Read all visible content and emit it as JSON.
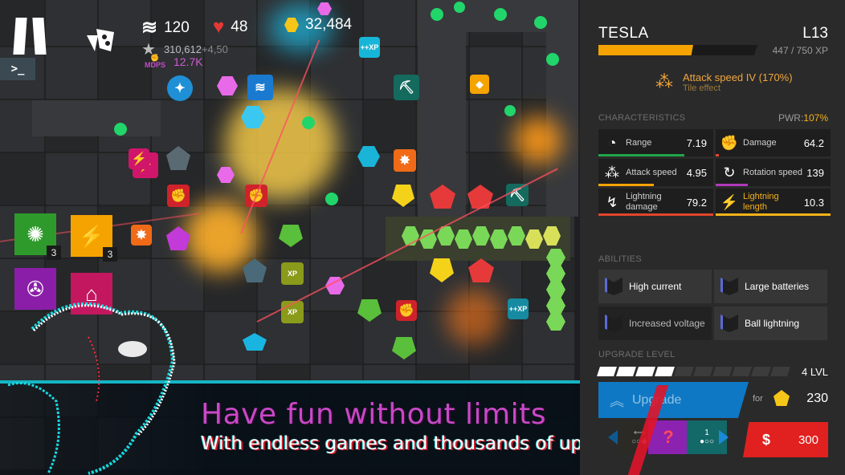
{
  "hud": {
    "pause_icon": "pause-icon",
    "console_label": ">_",
    "waves": "120",
    "lives": "48",
    "coins": "32,484",
    "score": "310,612",
    "score_delta": "+4,50",
    "mdps_label": "MDPS",
    "mdps_value": "12.7K"
  },
  "field": {
    "tile_cards": [
      {
        "icon": "explosion-icon",
        "count": "3",
        "color": "#2f9a2c"
      },
      {
        "icon": "flak-icon",
        "count": "3",
        "color": "#f5a300"
      },
      {
        "icon": "blast-icon",
        "count": "",
        "color": "#8a1ea8"
      },
      {
        "icon": "cannon-icon",
        "count": "",
        "color": "#c3175f"
      }
    ],
    "xp_badge": "++ XP"
  },
  "banner": {
    "title": "Have fun without limits",
    "subtitle": "With endless games and thousands of upgrades"
  },
  "panel": {
    "tower_name": "TESLA",
    "tower_level": "L13",
    "xp_current": 447,
    "xp_max": 750,
    "xp_text": "447 / 750 XP",
    "xp_fraction": 0.596,
    "effect": {
      "title": "Attack speed IV (170%)",
      "subtitle": "Tile effect"
    },
    "characteristics_label": "CHARACTERISTICS",
    "pwr_label": "PWR:",
    "pwr_value": "107%",
    "stats": [
      {
        "label": "Range",
        "value": "7.19",
        "icon": "range-icon",
        "bar_color": "#1fa64a",
        "bar_fraction": 0.75
      },
      {
        "label": "Damage",
        "value": "64.2",
        "icon": "fist-icon",
        "bar_color": "#e0462a",
        "bar_fraction": 0.03
      },
      {
        "label": "Attack speed",
        "value": "4.95",
        "icon": "attack-speed-icon",
        "bar_color": "#f5a300",
        "bar_fraction": 0.48
      },
      {
        "label": "Rotation speed",
        "value": "139",
        "icon": "rotation-icon",
        "bar_color": "#b03ab8",
        "bar_fraction": 0.28
      },
      {
        "label": "Lightning damage",
        "value": "79.2",
        "icon": "lightning-damage-icon",
        "bar_color": "#e0462a",
        "bar_fraction": 1.0
      },
      {
        "label": "Lightning length",
        "value": "10.3",
        "icon": "lightning-length-icon",
        "bar_color": "#f5b21a",
        "bar_fraction": 1.0,
        "highlight": "#f5b21a"
      }
    ],
    "abilities_label": "ABILITIES",
    "abilities": [
      {
        "label": "High current",
        "active": true
      },
      {
        "label": "Large batteries",
        "active": true
      },
      {
        "label": "Increased voltage",
        "active": false
      },
      {
        "label": "Ball lightning",
        "active": true
      }
    ],
    "upgrade_level_label": "UPGRADE LEVEL",
    "upgrade_level": 4,
    "upgrade_level_max": 10,
    "upgrade_level_text": "4 LVL",
    "upgrade_button": "Upgrade",
    "for_label": "for",
    "upgrade_cost": "230",
    "sell_value": "300",
    "sell_icon": "sell-icon",
    "mod_slots": [
      {
        "label": "",
        "icon": "range-mod-icon"
      },
      {
        "label": "?",
        "icon": "unknown-mod-icon"
      },
      {
        "label": "1",
        "icon": "drop-mod-icon"
      }
    ]
  },
  "colors": {
    "accent_orange": "#f5a300",
    "accent_cyan": "#15b5c4",
    "banner_title": "#c948c8",
    "sell_red": "#e0211f",
    "upgrade_blue": "#0f78c4"
  }
}
